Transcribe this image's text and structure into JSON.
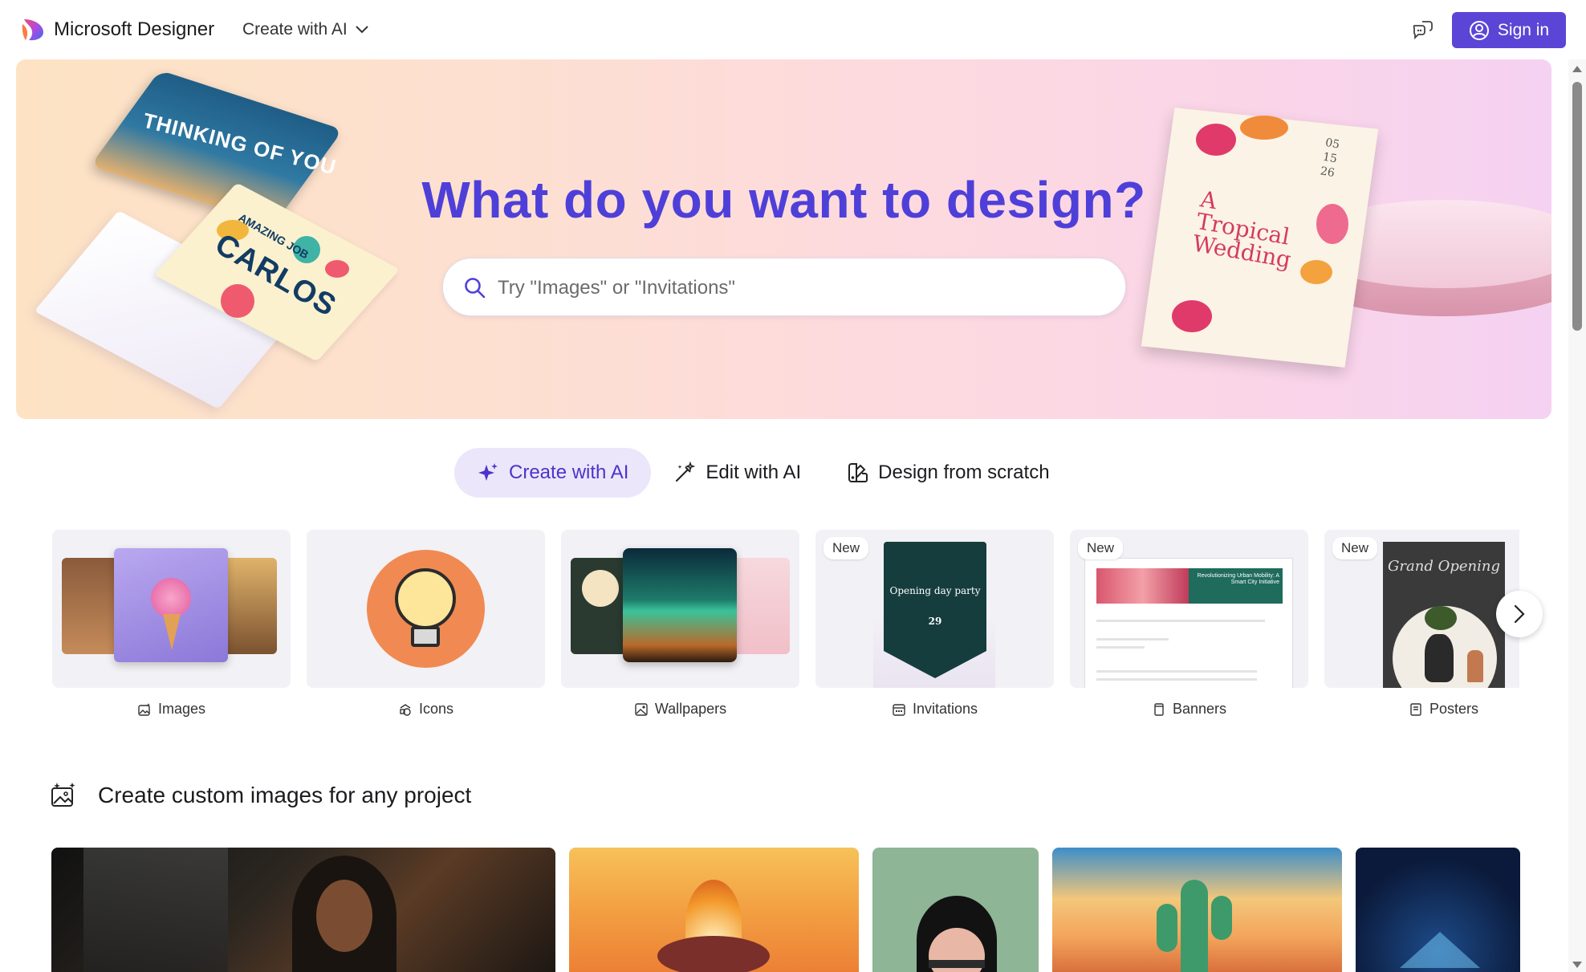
{
  "header": {
    "brand": "Microsoft Designer",
    "create_menu_label": "Create with AI",
    "sign_in_label": "Sign in"
  },
  "hero": {
    "title": "What do you want to design?",
    "search_placeholder": "Try \"Images\" or \"Invitations\"",
    "card_text_1": "THINKING OF YOU",
    "card_text_2": "CARLOS",
    "card_text_3": "AMAZING JOB",
    "wedding_title": "A Tropical Wedding",
    "wedding_date": "05\n15\n26"
  },
  "tabs": [
    {
      "label": "Create with AI",
      "icon": "sparkle-icon",
      "active": true
    },
    {
      "label": "Edit with AI",
      "icon": "magic-wand-icon",
      "active": false
    },
    {
      "label": "Design from scratch",
      "icon": "design-scratch-icon",
      "active": false
    }
  ],
  "categories": [
    {
      "label": "Images",
      "icon": "image-sparkle-icon",
      "new": false
    },
    {
      "label": "Icons",
      "icon": "icon-shapes-icon",
      "new": false
    },
    {
      "label": "Wallpapers",
      "icon": "wallpaper-icon",
      "new": false
    },
    {
      "label": "Invitations",
      "icon": "calendar-icon",
      "new": true,
      "thumb_text": "Opening day party",
      "thumb_num": "29"
    },
    {
      "label": "Banners",
      "icon": "banner-icon",
      "new": true,
      "thumb_text": "Revolutionizing Urban Mobility: A Smart City Initiative"
    },
    {
      "label": "Posters",
      "icon": "poster-icon",
      "new": true,
      "thumb_text": "Grand Opening"
    }
  ],
  "new_badge": "New",
  "section": {
    "title": "Create custom images for any project",
    "icon": "image-sparkle-icon"
  },
  "colors": {
    "accent": "#5b45d6",
    "hero_title": "#4f3fd9",
    "tab_active_bg": "#ece6fb"
  }
}
